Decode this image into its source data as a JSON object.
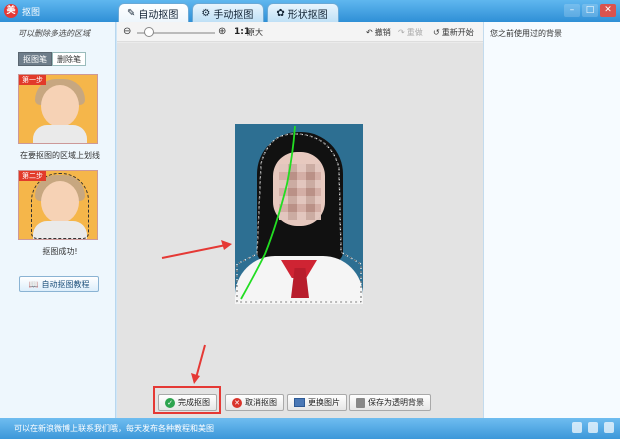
{
  "window": {
    "app_title": "抠图",
    "tabs": [
      {
        "label": "自动抠图",
        "icon": "brush-icon",
        "active": true
      },
      {
        "label": "手动抠图",
        "icon": "gear-icon",
        "active": false
      },
      {
        "label": "形状抠图",
        "icon": "shape-icon",
        "active": false
      }
    ]
  },
  "left_panel": {
    "hint": "可以删除多选的区域",
    "brush_tabs": [
      "抠图笔",
      "删除笔"
    ],
    "step1_label": "第一步",
    "step1_caption": "在要抠图的区域上划线",
    "step2_label": "第二步",
    "step2_caption": "抠图成功!",
    "tutorial_button": "自动抠图教程"
  },
  "toolbar": {
    "zoom_ratio": "1:1",
    "original_size": "原大",
    "undo": "撤销",
    "redo": "重做",
    "restart": "重新开始"
  },
  "bottom_buttons": {
    "finish": "完成抠图",
    "cancel": "取消抠图",
    "replace": "更换图片",
    "save_transparent": "保存为透明背景"
  },
  "right_panel": {
    "title": "您之前使用过的背景"
  },
  "status_bar": {
    "text": "可以在新浪微博上联系我们哦，每天发布各种教程和美图"
  },
  "colors": {
    "accent_blue": "#2f8fd6",
    "annotation_red": "#e53935",
    "stroke_green": "#22dd22"
  }
}
